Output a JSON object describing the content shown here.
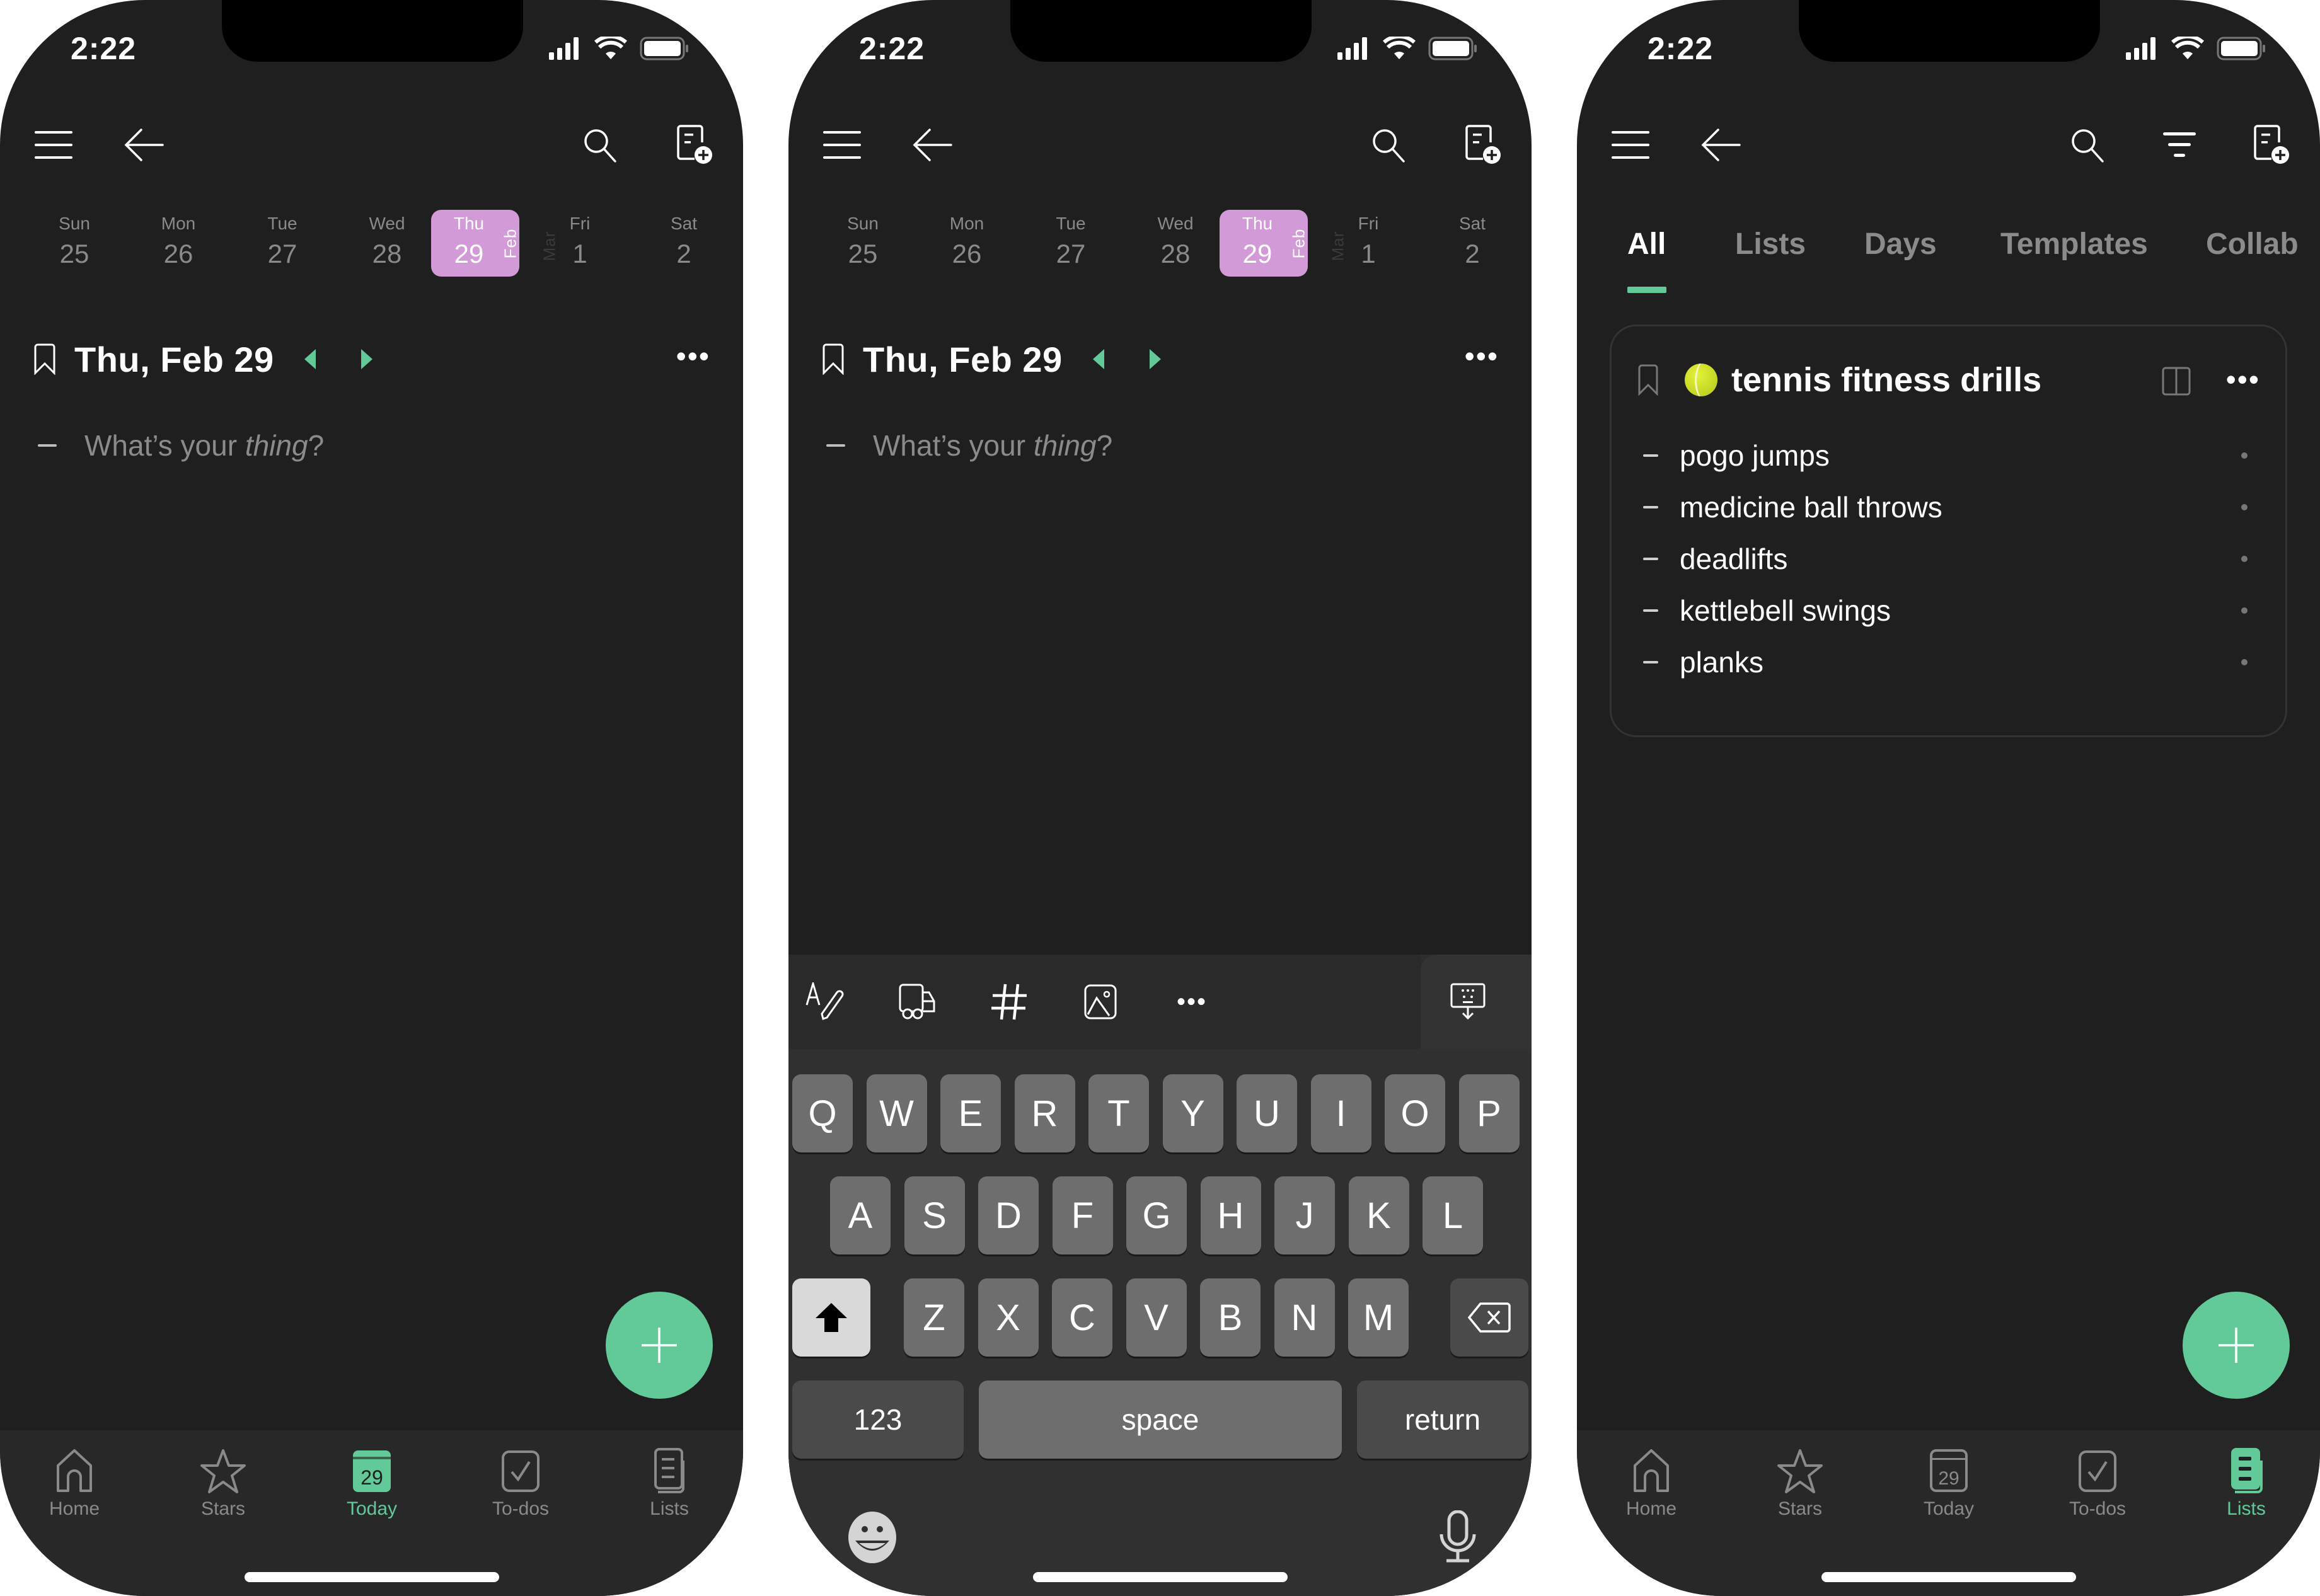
{
  "status_bar": {
    "time": "2:22"
  },
  "colors": {
    "accent": "#62c998",
    "today_highlight": "#d39ad8",
    "background": "#1f1f1f",
    "tabbar": "#282828"
  },
  "week": {
    "days": [
      {
        "name": "Sun",
        "date": "25"
      },
      {
        "name": "Mon",
        "date": "26"
      },
      {
        "name": "Tue",
        "date": "27"
      },
      {
        "name": "Wed",
        "date": "28"
      },
      {
        "name": "Thu",
        "date": "29",
        "selected": true
      },
      {
        "name": "Fri",
        "date": "1"
      },
      {
        "name": "Sat",
        "date": "2"
      }
    ],
    "month_current": "Feb",
    "month_next": "Mar"
  },
  "day_view": {
    "title": "Thu, Feb 29",
    "placeholder_plain": "What’s your ",
    "placeholder_italic": "thing",
    "placeholder_end": "?"
  },
  "tabbar": {
    "items": [
      {
        "label": "Home",
        "icon": "home-icon"
      },
      {
        "label": "Stars",
        "icon": "star-icon"
      },
      {
        "label": "Today",
        "icon": "calendar-29-icon",
        "badge": "29"
      },
      {
        "label": "To-dos",
        "icon": "checkbox-icon"
      },
      {
        "label": "Lists",
        "icon": "lists-icon"
      }
    ],
    "active_phone1": "Today",
    "active_phone3": "Lists"
  },
  "keyboard": {
    "toolbar": [
      "text-format-icon",
      "truck-icon",
      "hashtag-icon",
      "image-icon",
      "more-icon",
      "keyboard-dismiss-icon"
    ],
    "row1": [
      "Q",
      "W",
      "E",
      "R",
      "T",
      "Y",
      "U",
      "I",
      "O",
      "P"
    ],
    "row2": [
      "A",
      "S",
      "D",
      "F",
      "G",
      "H",
      "J",
      "K",
      "L"
    ],
    "row3": [
      "Z",
      "X",
      "C",
      "V",
      "B",
      "N",
      "M"
    ],
    "numbers_label": "123",
    "space_label": "space",
    "return_label": "return"
  },
  "lists_view": {
    "filter_tabs": [
      "All",
      "Lists",
      "Days",
      "Templates",
      "Collab"
    ],
    "active_filter": "All",
    "card": {
      "emoji": "tennis-ball",
      "title": "tennis fitness drills",
      "items": [
        "pogo jumps",
        "medicine ball throws",
        "deadlifts",
        "kettlebell swings",
        "planks"
      ]
    }
  }
}
